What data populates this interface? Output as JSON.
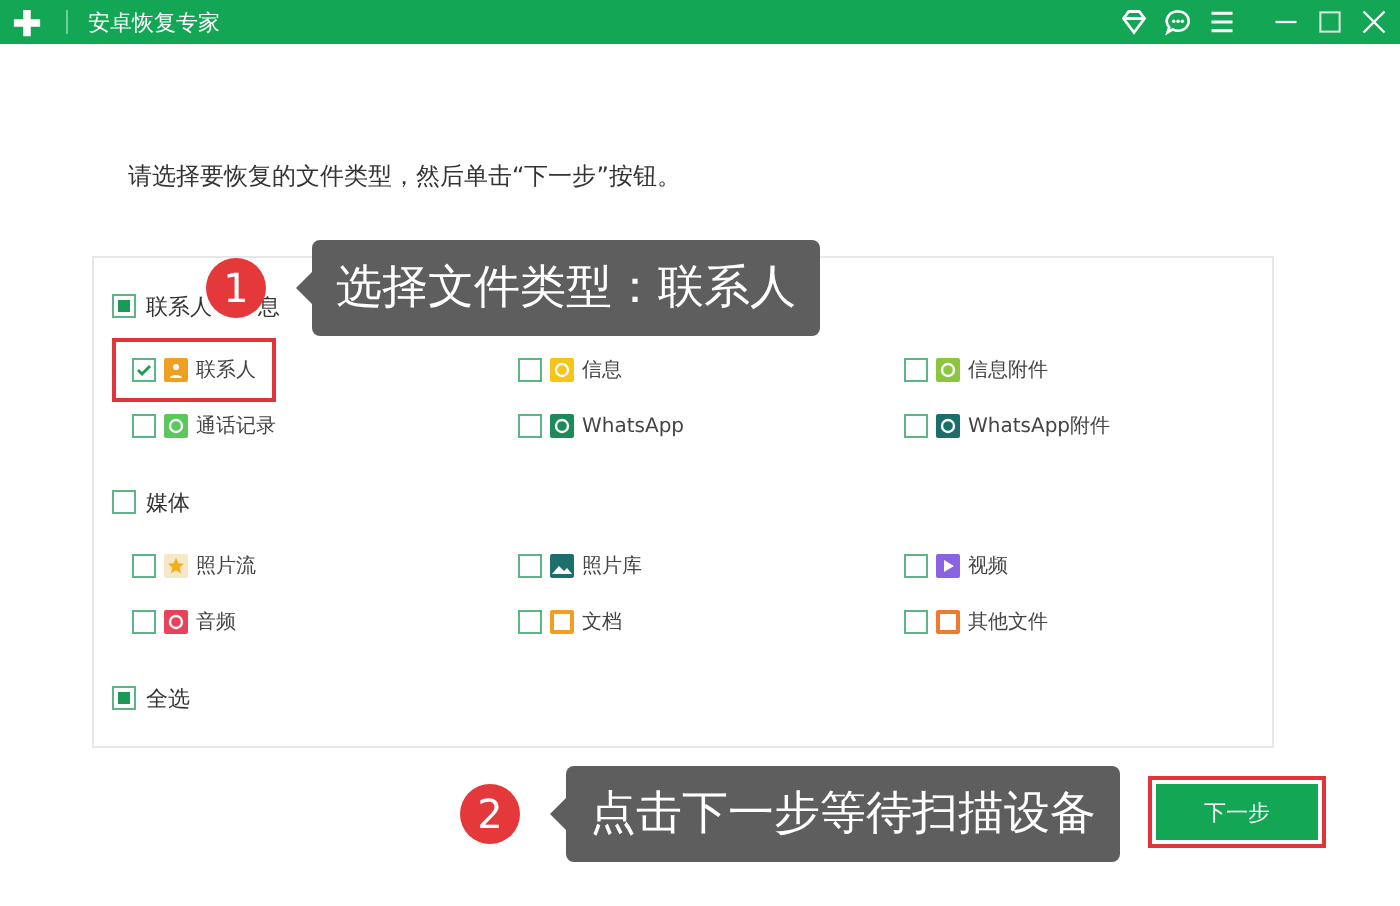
{
  "window": {
    "title": "安卓恢复专家"
  },
  "instruction": "请选择要恢复的文件类型，然后单击“下一步”按钮。",
  "groups": [
    {
      "label_parts": [
        "联系人",
        "息"
      ],
      "checked": false,
      "partial": true,
      "items": [
        {
          "label": "联系人",
          "kind": "contact",
          "checked": true,
          "highlighted": true
        },
        {
          "label": "信息",
          "kind": "message",
          "checked": false,
          "highlighted": false
        },
        {
          "label": "信息附件",
          "kind": "attachment",
          "checked": false,
          "highlighted": false
        },
        {
          "label": "通话记录",
          "kind": "call",
          "checked": false,
          "highlighted": false
        },
        {
          "label": "WhatsApp",
          "kind": "whatsapp",
          "checked": false,
          "highlighted": false
        },
        {
          "label": "WhatsApp附件",
          "kind": "whatsapp-attachment",
          "checked": false,
          "highlighted": false
        }
      ]
    },
    {
      "label_parts": [
        "媒体"
      ],
      "checked": false,
      "partial": false,
      "items": [
        {
          "label": "照片流",
          "kind": "photostream",
          "checked": false,
          "highlighted": false
        },
        {
          "label": "照片库",
          "kind": "photo-library",
          "checked": false,
          "highlighted": false
        },
        {
          "label": "视频",
          "kind": "video",
          "checked": false,
          "highlighted": false
        },
        {
          "label": "音频",
          "kind": "audio",
          "checked": false,
          "highlighted": false
        },
        {
          "label": "文档",
          "kind": "document",
          "checked": false,
          "highlighted": false
        },
        {
          "label": "其他文件",
          "kind": "other",
          "checked": false,
          "highlighted": false
        }
      ]
    }
  ],
  "select_all": {
    "label": "全选",
    "checked": false,
    "partial": true
  },
  "next_button": {
    "label": "下一步",
    "highlighted": true
  },
  "callouts": [
    {
      "number": "1",
      "text": "选择文件类型：联系人"
    },
    {
      "number": "2",
      "text": "点击下一步等待扫描设备"
    }
  ]
}
